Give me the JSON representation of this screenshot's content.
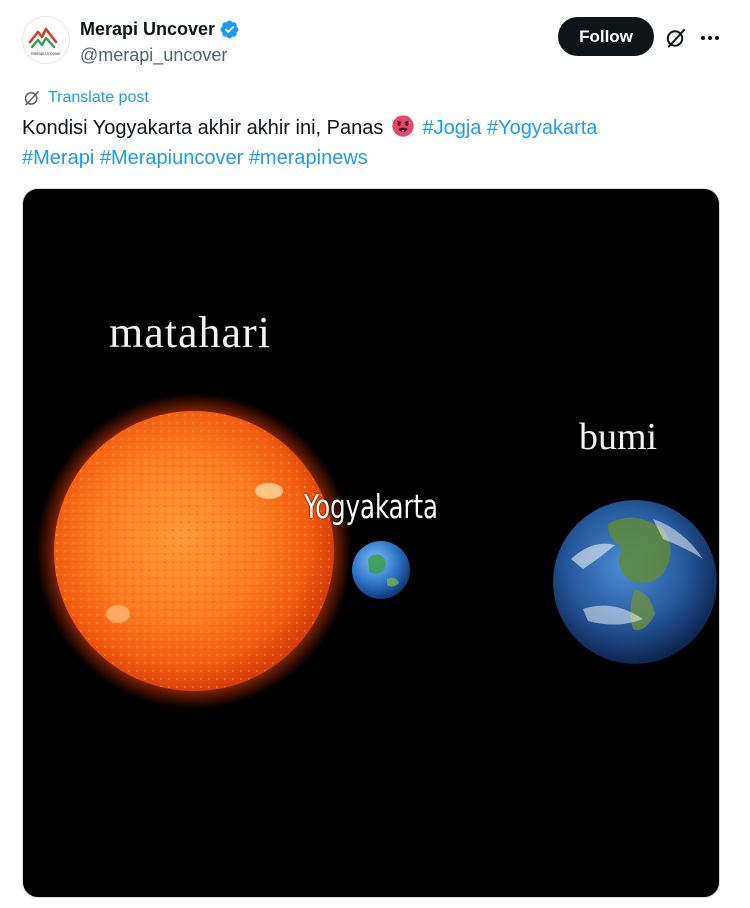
{
  "author": {
    "name": "Merapi Uncover",
    "handle": "@merapi_uncover",
    "avatar_text": "Merapi Uncover",
    "verified_icon": "verified-badge-icon",
    "verified_color": "#1d9bf0"
  },
  "actions": {
    "follow_label": "Follow",
    "grok_icon": "grok-icon",
    "more_icon": "more-icon"
  },
  "translate": {
    "label": "Translate post",
    "icon": "translate-icon"
  },
  "post": {
    "text_start": "Kondisi Yogyakarta akhir akhir ini, Panas",
    "emoji": "hot-face-emoji",
    "hashtags": [
      "#Jogja",
      "#Yogyakarta",
      "#Merapi",
      "#Merapiuncover",
      "#merapinews"
    ]
  },
  "media": {
    "label_sun": "matahari",
    "label_earth": "bumi",
    "label_city": "Yogyakarta"
  },
  "colors": {
    "accent": "#1d9bf0",
    "text": "#0f1419",
    "secondary": "#536471",
    "button_bg": "#0f1419"
  }
}
